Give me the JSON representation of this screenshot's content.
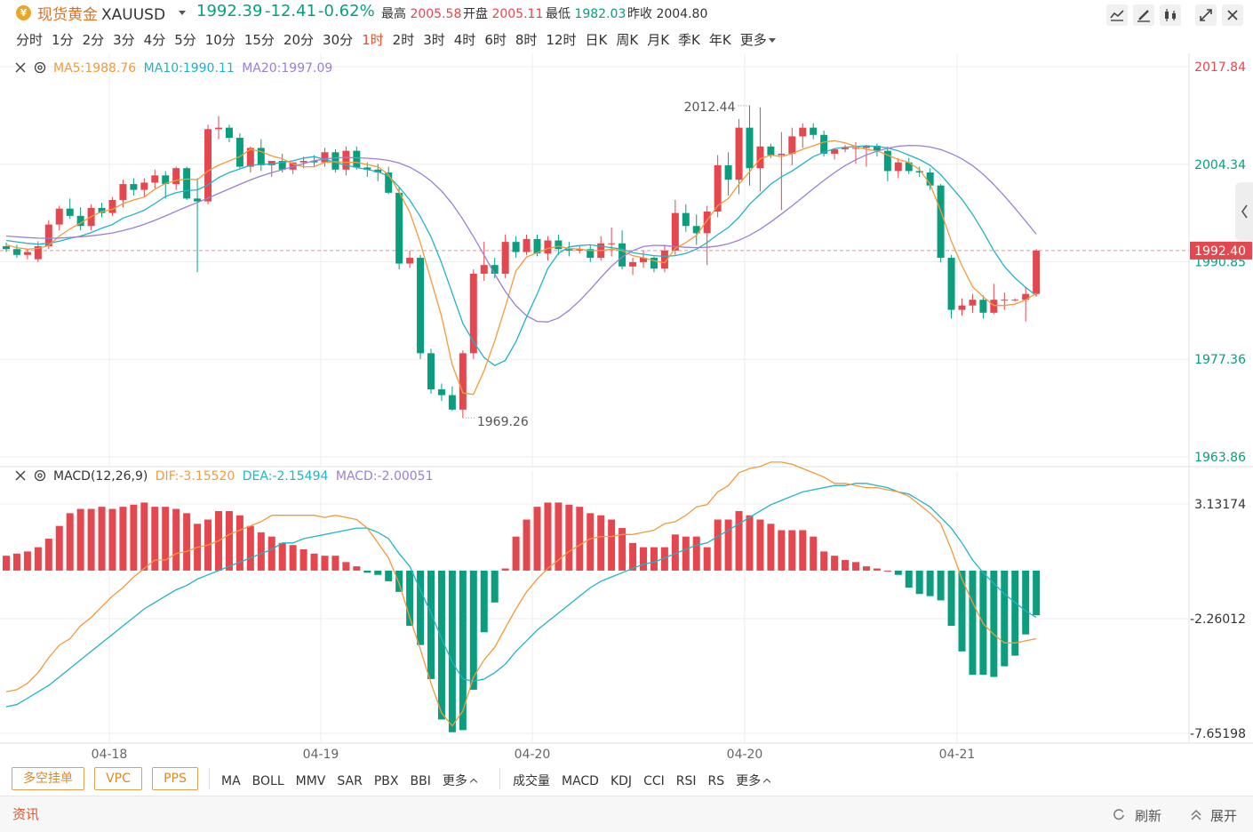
{
  "header": {
    "title": "现货黄金",
    "symbol": "XAUUSD",
    "last_price": "1992.39",
    "change": "-12.41",
    "change_pct": "-0.62%",
    "high_label": "最高",
    "high_value": "2005.58",
    "open_label": "开盘",
    "open_value": "2005.11",
    "low_label": "最低",
    "low_value": "1982.03",
    "prev_label": "昨收",
    "prev_value": "2004.80",
    "up_color": "#e5474f",
    "down_color": "#0a9e7f"
  },
  "toolbar_icons": [
    "line-chart-icon",
    "draw-pen-icon",
    "candle-style-icon",
    "fullscreen-icon",
    "close-icon"
  ],
  "periods": {
    "items": [
      "分时",
      "1分",
      "2分",
      "3分",
      "4分",
      "5分",
      "10分",
      "15分",
      "20分",
      "30分",
      "1时",
      "2时",
      "3时",
      "4时",
      "6时",
      "8时",
      "12时",
      "日K",
      "周K",
      "月K",
      "季K",
      "年K"
    ],
    "active": "1时",
    "more": "更多"
  },
  "main_legend": {
    "ma5": "MA5:1988.76",
    "ma10": "MA10:1990.11",
    "ma20": "MA20:1997.09",
    "ma5_color": "#f29a3c",
    "ma10_color": "#21b3c6",
    "ma20_color": "#9b7fd4"
  },
  "macd_legend": {
    "name": "MACD(12,26,9)",
    "dif": "DIF:-3.15520",
    "dea": "DEA:-2.15494",
    "macd": "MACD:-2.00051"
  },
  "chart_data": [
    {
      "type": "candlestick",
      "title": "",
      "yticks": [
        2017.84,
        2004.34,
        1990.85,
        1977.36,
        1963.86
      ],
      "ylim": [
        1963.86,
        2017.84
      ],
      "xtick_labels": [
        "04-18",
        "04-19",
        "04-20",
        "04-20",
        "04-21"
      ],
      "current_price_label": "1992.40",
      "annotations": [
        {
          "text": "2012.44",
          "value": 2012.44
        },
        {
          "text": "1969.26",
          "value": 1969.26
        }
      ],
      "ohlc": [
        [
          1993.0,
          1993.5,
          1992.2,
          1992.6
        ],
        [
          1992.6,
          1993.2,
          1991.4,
          1991.8
        ],
        [
          1991.8,
          1992.6,
          1991.2,
          1992.2
        ],
        [
          1991.2,
          1993.7,
          1990.8,
          1993.0
        ],
        [
          1993.0,
          1996.6,
          1992.6,
          1996.0
        ],
        [
          1996.0,
          1998.6,
          1995.2,
          1998.2
        ],
        [
          1998.2,
          1999.6,
          1996.8,
          1997.2
        ],
        [
          1997.2,
          1998.4,
          1995.2,
          1995.8
        ],
        [
          1995.8,
          1998.8,
          1995.2,
          1998.3
        ],
        [
          1998.3,
          1999.0,
          1997.0,
          1997.6
        ],
        [
          1997.6,
          1999.8,
          1997.2,
          1999.4
        ],
        [
          1999.4,
          2002.2,
          1998.4,
          2001.6
        ],
        [
          2001.6,
          2002.4,
          2000.0,
          2000.8
        ],
        [
          2000.8,
          2002.4,
          1999.8,
          2001.8
        ],
        [
          2001.8,
          2003.6,
          2001.0,
          2002.8
        ],
        [
          2002.8,
          2003.4,
          1999.6,
          2001.6
        ],
        [
          2001.6,
          2004.0,
          2000.8,
          2003.8
        ],
        [
          2003.8,
          2004.0,
          1999.4,
          1999.6
        ],
        [
          1999.6,
          2002.4,
          1989.4,
          1999.2
        ],
        [
          1999.2,
          2009.8,
          1998.8,
          2009.2
        ],
        [
          2009.2,
          2011.0,
          2007.8,
          2009.4
        ],
        [
          2009.4,
          2009.8,
          2007.4,
          2008.0
        ],
        [
          2008.0,
          2008.6,
          2003.8,
          2004.0
        ],
        [
          2004.0,
          2006.8,
          2003.2,
          2006.6
        ],
        [
          2006.6,
          2007.8,
          2003.4,
          2004.2
        ],
        [
          2004.2,
          2004.8,
          2002.6,
          2004.8
        ],
        [
          2004.8,
          2005.8,
          2003.2,
          2003.6
        ],
        [
          2003.6,
          2004.6,
          2003.0,
          2004.6
        ],
        [
          2004.6,
          2005.4,
          2003.8,
          2004.8
        ],
        [
          2004.8,
          2005.6,
          2004.0,
          2004.6
        ],
        [
          2004.6,
          2006.6,
          2004.0,
          2006.0
        ],
        [
          2006.0,
          2006.4,
          2003.2,
          2003.6
        ],
        [
          2003.6,
          2006.8,
          2002.8,
          2006.2
        ],
        [
          2006.2,
          2006.8,
          2003.6,
          2003.9
        ],
        [
          2003.9,
          2004.6,
          2002.6,
          2003.6
        ],
        [
          2003.6,
          2004.4,
          2002.0,
          2003.2
        ],
        [
          2003.2,
          2004.0,
          2000.2,
          2000.4
        ],
        [
          2000.4,
          2001.2,
          1989.8,
          1990.6
        ],
        [
          1990.6,
          1992.4,
          1990.0,
          1991.4
        ],
        [
          1991.4,
          1991.8,
          1977.4,
          1978.2
        ],
        [
          1978.2,
          1978.8,
          1972.6,
          1973.2
        ],
        [
          1973.2,
          1974.0,
          1971.6,
          1972.4
        ],
        [
          1972.4,
          1973.6,
          1970.2,
          1970.4
        ],
        [
          1970.4,
          1978.6,
          1969.26,
          1978.2
        ],
        [
          1978.2,
          1989.8,
          1977.4,
          1989.2
        ],
        [
          1989.2,
          1993.6,
          1988.2,
          1990.4
        ],
        [
          1990.4,
          1991.4,
          1988.6,
          1989.2
        ],
        [
          1989.2,
          1994.6,
          1988.6,
          1993.6
        ],
        [
          1993.6,
          1994.4,
          1991.4,
          1992.2
        ],
        [
          1992.2,
          1994.6,
          1991.8,
          1994.0
        ],
        [
          1994.0,
          1994.6,
          1991.6,
          1992.0
        ],
        [
          1992.0,
          1994.4,
          1991.0,
          1993.8
        ],
        [
          1993.8,
          1994.6,
          1991.8,
          1992.6
        ],
        [
          1992.6,
          1993.6,
          1991.6,
          1992.4
        ],
        [
          1992.4,
          1993.0,
          1992.0,
          1992.6
        ],
        [
          1992.6,
          1993.2,
          1990.8,
          1991.4
        ],
        [
          1991.4,
          1994.4,
          1991.0,
          1993.4
        ],
        [
          1993.4,
          1995.6,
          1991.6,
          1993.4
        ],
        [
          1993.4,
          1995.2,
          1989.8,
          1990.2
        ],
        [
          1990.2,
          1991.4,
          1989.0,
          1990.8
        ],
        [
          1990.8,
          1992.4,
          1990.0,
          1991.4
        ],
        [
          1991.4,
          1991.6,
          1989.4,
          1989.9
        ],
        [
          1989.9,
          1993.2,
          1989.4,
          1992.4
        ],
        [
          1992.4,
          1999.4,
          1991.8,
          1997.6
        ],
        [
          1997.6,
          1998.8,
          1995.0,
          1995.8
        ],
        [
          1995.8,
          1997.4,
          1993.2,
          1994.8
        ],
        [
          1994.8,
          1998.6,
          1990.4,
          1997.8
        ],
        [
          1997.8,
          2005.6,
          1997.0,
          2004.2
        ],
        [
          2004.2,
          2006.0,
          2000.0,
          2002.2
        ],
        [
          2002.2,
          2010.6,
          2000.2,
          2009.4
        ],
        [
          2009.4,
          2012.44,
          2001.4,
          2003.8
        ],
        [
          2003.8,
          2012.2,
          2000.6,
          2006.8
        ],
        [
          2006.8,
          2007.2,
          2005.2,
          2005.6
        ],
        [
          2005.6,
          2008.8,
          1998.0,
          2005.8
        ],
        [
          2005.8,
          2009.4,
          2004.2,
          2008.2
        ],
        [
          2008.2,
          2010.0,
          2006.6,
          2009.4
        ],
        [
          2009.4,
          2010.0,
          2007.8,
          2008.4
        ],
        [
          2008.4,
          2009.0,
          2005.4,
          2005.8
        ],
        [
          2005.8,
          2006.6,
          2005.0,
          2006.4
        ],
        [
          2006.4,
          2007.0,
          2006.0,
          2006.6
        ],
        [
          2006.6,
          2007.4,
          2004.4,
          2006.6
        ],
        [
          2006.6,
          2007.0,
          2004.0,
          2006.9
        ],
        [
          2006.9,
          2007.2,
          2005.4,
          2006.2
        ],
        [
          2006.2,
          2006.8,
          2002.0,
          2003.4
        ],
        [
          2003.4,
          2005.2,
          2002.4,
          2004.6
        ],
        [
          2004.6,
          2005.2,
          2003.0,
          2003.4
        ],
        [
          2003.4,
          2004.0,
          2002.6,
          2003.2
        ],
        [
          2003.2,
          2003.8,
          2000.8,
          2001.4
        ],
        [
          2001.4,
          2001.6,
          1990.8,
          1991.4
        ],
        [
          1991.4,
          1991.8,
          1983.0,
          1984.2
        ],
        [
          1984.2,
          1985.8,
          1983.4,
          1984.8
        ],
        [
          1984.8,
          1986.4,
          1983.8,
          1985.6
        ],
        [
          1985.6,
          1986.2,
          1983.0,
          1983.8
        ],
        [
          1983.8,
          1987.8,
          1983.6,
          1985.6
        ],
        [
          1985.6,
          1986.6,
          1984.2,
          1985.6
        ],
        [
          1985.6,
          1985.8,
          1985.4,
          1985.6
        ],
        [
          1985.6,
          1987.4,
          1982.6,
          1986.4
        ],
        [
          1986.4,
          1992.6,
          1986.0,
          1992.4
        ]
      ],
      "ma5": [
        1993.2,
        1992.8,
        1992.6,
        1992.7,
        1993.1,
        1994.4,
        1995.4,
        1996.2,
        1997.1,
        1997.8,
        1998.1,
        1998.9,
        1999.4,
        1999.8,
        2000.9,
        2001.7,
        2002.1,
        2002.3,
        2002.2,
        2003.4,
        2004.2,
        2004.8,
        2005.4,
        2006.4,
        2006.1,
        2005.5,
        2005.1,
        2004.4,
        2004.0,
        2004.0,
        2004.6,
        2004.7,
        2004.6,
        2004.6,
        2004.3,
        2004.0,
        2002.9,
        2000.5,
        1997.7,
        1993.5,
        1988.3,
        1983.3,
        1976.6,
        1972.7,
        1972.5,
        1975.8,
        1979.9,
        1984.6,
        1989.6,
        1991.5,
        1992.1,
        1992.7,
        1993.0,
        1992.7,
        1992.6,
        1992.4,
        1992.4,
        1992.6,
        1992.4,
        1991.7,
        1991.4,
        1991.0,
        1990.7,
        1992.7,
        1993.5,
        1994.5,
        1996.6,
        1998.6,
        1999.6,
        2001.6,
        2003.3,
        2005.1,
        2005.6,
        2005.4,
        2005.8,
        2006.4,
        2006.9,
        2007.4,
        2007.6,
        2007.3,
        2006.8,
        2006.4,
        2006.2,
        2005.6,
        2005.0,
        2004.6,
        2003.6,
        2001.6,
        1997.9,
        1993.7,
        1990.3,
        1987.4,
        1986.0,
        1984.8,
        1984.8,
        1985.0,
        1985.6,
        1986.5
      ],
      "ma10": [
        1993.8,
        1993.6,
        1993.4,
        1993.3,
        1993.4,
        1993.7,
        1994.1,
        1994.4,
        1994.9,
        1995.5,
        1996.0,
        1996.9,
        1997.4,
        1998.0,
        1998.9,
        1999.9,
        2000.4,
        2000.7,
        2000.8,
        2001.5,
        2002.5,
        2003.2,
        2003.7,
        2004.2,
        2004.3,
        2004.4,
        2004.6,
        2004.8,
        2005.2,
        2005.4,
        2005.0,
        2004.6,
        2004.2,
        2003.9,
        2003.6,
        2003.3,
        2002.7,
        2001.2,
        1999.4,
        1997.1,
        1994.3,
        1990.7,
        1986.5,
        1982.3,
        1979.8,
        1977.6,
        1976.5,
        1977.2,
        1979.8,
        1983.2,
        1986.4,
        1989.9,
        1992.0,
        1992.9,
        1993.1,
        1993.2,
        1993.0,
        1992.8,
        1992.6,
        1992.1,
        1991.9,
        1991.7,
        1991.6,
        1991.7,
        1992.0,
        1992.6,
        1993.5,
        1994.6,
        1995.6,
        1997.0,
        1998.8,
        2000.2,
        2001.6,
        2002.6,
        2003.4,
        2004.4,
        2005.4,
        2006.0,
        2006.5,
        2006.7,
        2006.8,
        2006.9,
        2006.8,
        2006.6,
        2006.2,
        2005.6,
        2005.0,
        2004.2,
        2002.9,
        2001.2,
        1999.5,
        1997.4,
        1995.0,
        1992.4,
        1990.2,
        1988.6,
        1987.3,
        1986.2
      ]
    },
    {
      "type": "bar+line",
      "title": "MACD(12,26,9)",
      "yticks": [
        3.13174,
        -2.26012,
        -7.65198
      ],
      "ylim": [
        -7.65198,
        3.13174
      ],
      "hist": [
        0.7,
        0.8,
        0.9,
        1.1,
        1.5,
        2.1,
        2.7,
        2.9,
        2.9,
        3.0,
        2.9,
        3.0,
        3.1,
        3.2,
        3.0,
        3.0,
        2.9,
        2.7,
        2.2,
        2.4,
        2.8,
        2.8,
        2.6,
        2.1,
        1.8,
        1.6,
        1.3,
        1.2,
        1.0,
        0.8,
        0.7,
        0.7,
        0.4,
        0.2,
        -0.1,
        -0.2,
        -0.5,
        -1.0,
        -2.6,
        -3.5,
        -5.1,
        -7.0,
        -7.6,
        -7.5,
        -5.6,
        -2.9,
        -1.5,
        0.1,
        1.6,
        2.4,
        3.0,
        3.2,
        3.2,
        3.1,
        3.0,
        2.7,
        2.6,
        2.4,
        2.0,
        1.3,
        1.1,
        1.1,
        1.1,
        1.7,
        1.6,
        1.6,
        1.1,
        2.4,
        2.4,
        2.8,
        2.6,
        2.4,
        2.2,
        1.9,
        1.9,
        1.9,
        1.6,
        0.9,
        0.7,
        0.5,
        0.4,
        0.2,
        0.1,
        0.0,
        -0.2,
        -0.8,
        -1.1,
        -1.2,
        -1.4,
        -2.6,
        -3.8,
        -4.9,
        -4.9,
        -5.0,
        -4.5,
        -4.0,
        -3.0,
        -2.1
      ],
      "dif": [
        -5.7,
        -5.6,
        -5.3,
        -4.8,
        -4.1,
        -3.5,
        -3.2,
        -2.6,
        -2.2,
        -1.7,
        -1.2,
        -0.8,
        -0.3,
        0.1,
        0.5,
        0.5,
        0.8,
        0.9,
        1.1,
        1.2,
        1.4,
        1.7,
        1.9,
        2.1,
        2.3,
        2.6,
        2.6,
        2.6,
        2.6,
        2.6,
        2.5,
        2.6,
        2.5,
        2.4,
        2.0,
        1.3,
        0.6,
        -0.6,
        -2.2,
        -3.7,
        -5.3,
        -6.7,
        -7.3,
        -6.6,
        -5.0,
        -4.2,
        -3.6,
        -2.7,
        -1.8,
        -1.0,
        -0.4,
        0.1,
        0.5,
        0.9,
        1.2,
        1.5,
        1.6,
        1.6,
        1.7,
        1.7,
        1.8,
        1.9,
        2.2,
        2.3,
        2.6,
        3.0,
        3.1,
        3.7,
        4.0,
        4.6,
        4.8,
        4.9,
        5.1,
        5.1,
        5.0,
        4.8,
        4.6,
        4.4,
        4.1,
        4.1,
        4.0,
        3.9,
        3.9,
        3.8,
        3.7,
        3.5,
        3.1,
        2.7,
        2.2,
        1.0,
        -0.4,
        -1.5,
        -2.5,
        -3.0,
        -3.4,
        -3.4,
        -3.3,
        -3.2
      ],
      "dea": [
        -6.4,
        -6.3,
        -6.0,
        -5.7,
        -5.4,
        -5.0,
        -4.6,
        -4.2,
        -3.8,
        -3.4,
        -3.0,
        -2.6,
        -2.2,
        -1.8,
        -1.5,
        -1.2,
        -0.9,
        -0.7,
        -0.4,
        -0.2,
        0.0,
        0.2,
        0.4,
        0.6,
        0.8,
        1.0,
        1.3,
        1.3,
        1.5,
        1.6,
        1.7,
        1.8,
        1.9,
        2.0,
        2.0,
        1.8,
        1.5,
        0.8,
        0.2,
        -0.9,
        -2.0,
        -3.2,
        -4.3,
        -5.1,
        -5.2,
        -5.1,
        -4.8,
        -4.4,
        -3.8,
        -3.3,
        -2.8,
        -2.4,
        -2.0,
        -1.6,
        -1.2,
        -0.8,
        -0.5,
        -0.3,
        -0.1,
        0.1,
        0.3,
        0.4,
        0.6,
        0.8,
        1.0,
        1.2,
        1.3,
        1.6,
        1.9,
        2.2,
        2.5,
        2.8,
        3.1,
        3.3,
        3.5,
        3.7,
        3.8,
        3.9,
        4.0,
        4.0,
        4.1,
        4.1,
        4.0,
        3.9,
        3.7,
        3.6,
        3.3,
        3.0,
        2.5,
        2.0,
        1.3,
        0.5,
        -0.1,
        -0.6,
        -1.1,
        -1.5,
        -1.9,
        -2.2
      ]
    }
  ],
  "bottom_bar": {
    "chips": [
      "多空挂单",
      "VPC",
      "PPS"
    ],
    "main_indicators": [
      "MA",
      "BOLL",
      "MMV",
      "SAR",
      "PBX",
      "BBI"
    ],
    "main_more": "更多",
    "sub_indicators": [
      "成交量",
      "MACD",
      "KDJ",
      "CCI",
      "RSI",
      "RS"
    ],
    "sub_more": "更多"
  },
  "news_bar": {
    "label": "资讯",
    "refresh": "刷新",
    "expand": "展开"
  }
}
